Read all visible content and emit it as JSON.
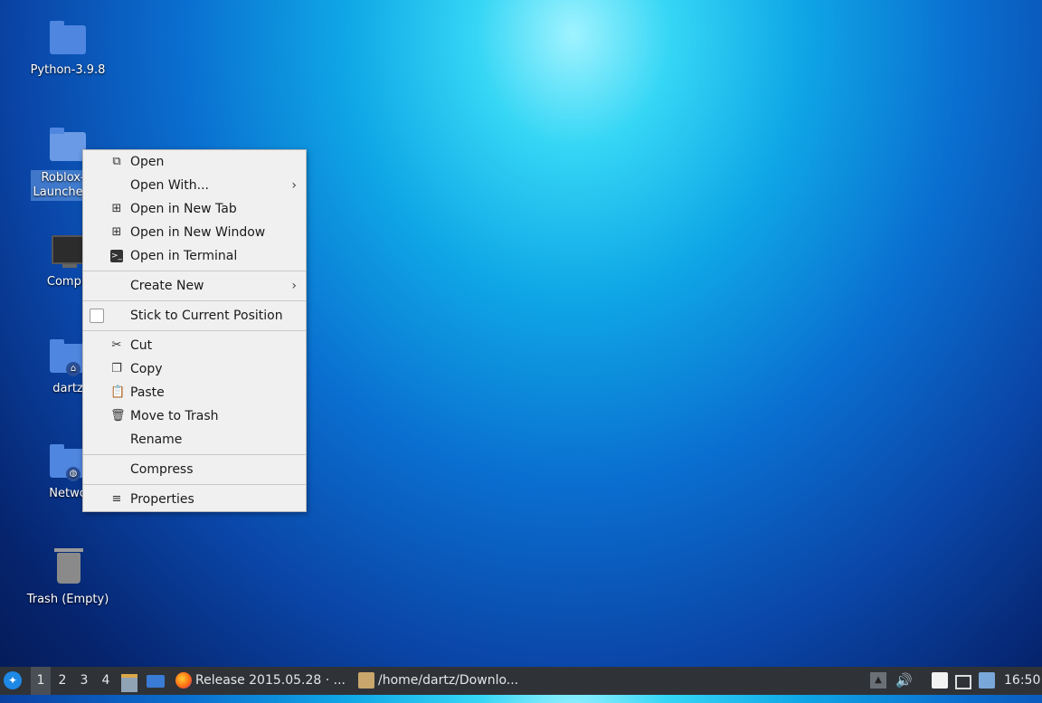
{
  "desktop": {
    "icons": [
      {
        "label": "Python-3.9.8",
        "icon": "folder-icon"
      },
      {
        "label_line1": "Roblox-Li",
        "label_line2": "Launcher-m",
        "icon": "folder-icon"
      },
      {
        "label": "Compu",
        "icon": "computer-icon"
      },
      {
        "label": "dartz",
        "icon": "home-folder-icon"
      },
      {
        "label": "Netwo",
        "icon": "network-folder-icon"
      },
      {
        "label": "Trash (Empty)",
        "icon": "trash-icon"
      }
    ]
  },
  "context_menu": {
    "items": [
      {
        "label": "Open",
        "icon": "open-icon"
      },
      {
        "label": "Open With...",
        "submenu": true
      },
      {
        "label": "Open in New Tab",
        "icon": "new-tab-icon"
      },
      {
        "label": "Open in New Window",
        "icon": "new-window-icon"
      },
      {
        "label": "Open in Terminal",
        "icon": "terminal-icon"
      },
      {
        "label": "Create New",
        "submenu": true
      },
      {
        "label": "Stick to Current Position",
        "checkbox": true,
        "checked": false
      },
      {
        "label": "Cut",
        "icon": "cut-icon"
      },
      {
        "label": "Copy",
        "icon": "copy-icon"
      },
      {
        "label": "Paste",
        "icon": "paste-icon"
      },
      {
        "label": "Move to Trash",
        "icon": "trash-icon"
      },
      {
        "label": "Rename"
      },
      {
        "label": "Compress"
      },
      {
        "label": "Properties",
        "icon": "properties-icon"
      }
    ]
  },
  "taskbar": {
    "workspaces": [
      "1",
      "2",
      "3",
      "4"
    ],
    "active_workspace": "1",
    "tasks": [
      {
        "label": "Release 2015.05.28 · ...",
        "icon": "firefox-icon"
      },
      {
        "label": "/home/dartz/Downlo...",
        "icon": "file-manager-icon"
      }
    ],
    "clock": "16:50"
  },
  "colors": {
    "menu_bg": "#f0f0f0",
    "taskbar_bg": "#2f3338",
    "folder_blue": "#4f86e0"
  }
}
